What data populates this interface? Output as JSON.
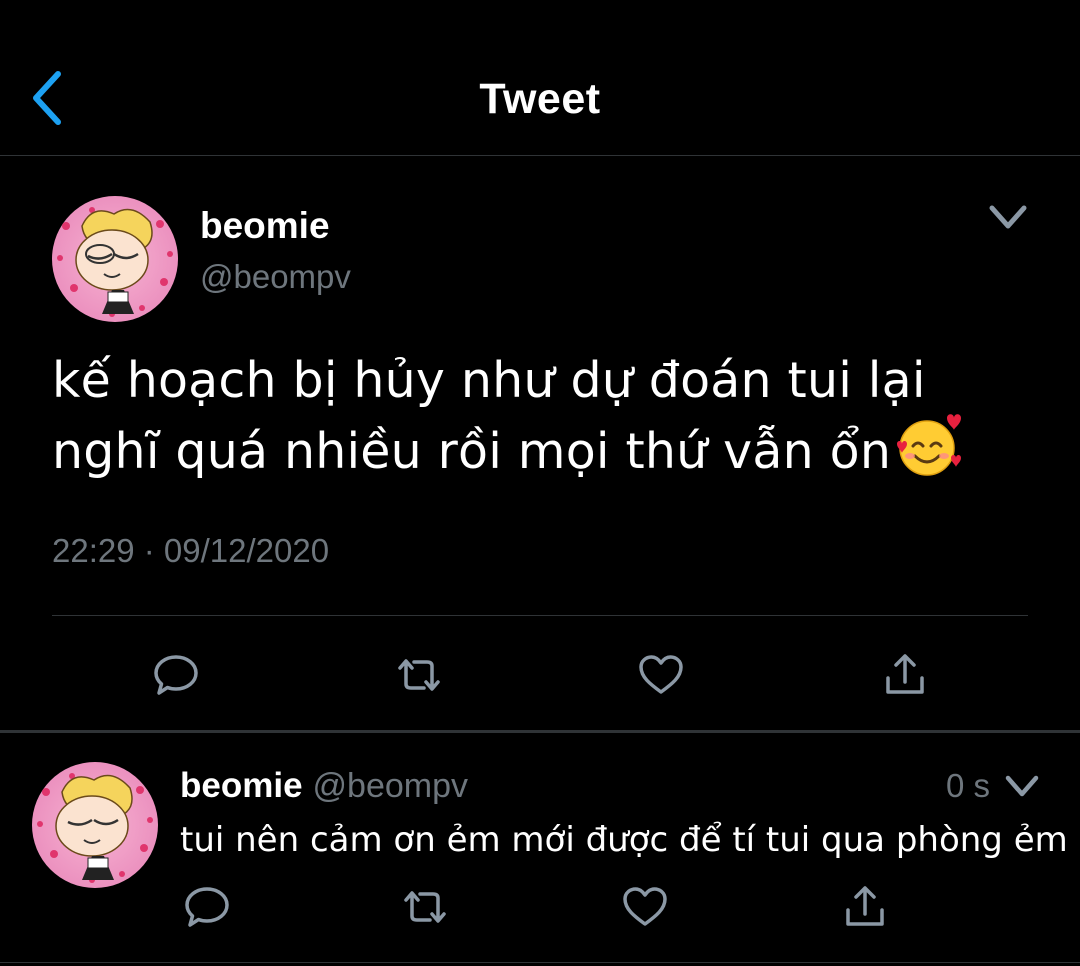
{
  "header": {
    "title": "Tweet",
    "back_icon": "chevron-left-icon",
    "accent_color": "#1da1f2"
  },
  "tweet": {
    "author_name": "beomie",
    "author_handle": "@beompv",
    "text_lines": [
      "kế hoạch bị hủy như dự đoán tui lại",
      "nghĩ quá nhiều rồi mọi thứ vẫn ổn"
    ],
    "emoji": "smiling-face-with-hearts",
    "timestamp": "22:29 · 09/12/2020",
    "actions": [
      "reply-icon",
      "retweet-icon",
      "like-icon",
      "share-icon"
    ]
  },
  "reply": {
    "author_name": "beomie",
    "author_handle": "@beompv",
    "time": "0 s",
    "text": "tui nên cảm ơn ẻm mới được để tí tui qua phòng ẻm",
    "actions": [
      "reply-icon",
      "retweet-icon",
      "like-icon",
      "share-icon"
    ]
  },
  "colors": {
    "background": "#000000",
    "text": "#ffffff",
    "secondary_text": "#6e767d",
    "divider": "#2f3336"
  }
}
